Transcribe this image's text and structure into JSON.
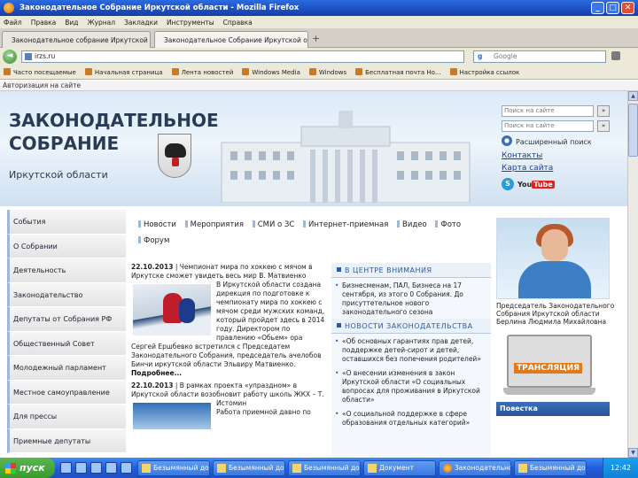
{
  "window": {
    "title": "Законодательное Собрание Иркутской области - Mozilla Firefox",
    "min": "_",
    "max": "□",
    "close": "✕"
  },
  "menu": [
    "Файл",
    "Правка",
    "Вид",
    "Журнал",
    "Закладки",
    "Инструменты",
    "Справка"
  ],
  "tabs": [
    {
      "label": "Законодательное собрание Иркутской"
    },
    {
      "label": "Законодательное Собрание Иркутской обл..."
    }
  ],
  "tab_close": "×",
  "tab_new": "+",
  "nav": {
    "url": "irzs.ru",
    "search_placeholder": "Google",
    "back_glyph": "◄"
  },
  "bookmarks": [
    "Часто посещаемые",
    "Начальная страница",
    "Лента новостей",
    "Windows Media",
    "Windows",
    "Бесплатная почта Ho...",
    "Настройка ссылок"
  ],
  "auth_bar": "Авторизация на сайте",
  "header": {
    "title_line1": "ЗАКОНОДАТЕЛЬНОЕ",
    "title_line2": "СОБРАНИЕ",
    "subtitle": "Иркутской области",
    "search1_placeholder": "Поиск на сайте",
    "search2_placeholder": "Поиск на сайте",
    "search_btn": "»",
    "ext_search": "Расширенный поиск",
    "link_contacts": "Контакты",
    "link_sitemap": "Карта сайта",
    "skype_letter": "S",
    "yt_you": "You",
    "yt_tube": "Tube"
  },
  "leftnav": [
    "События",
    "О Собрании",
    "Деятельность",
    "Законодательство",
    "Депутаты от Собрания РФ",
    "Общественный Совет",
    "Молодежный парламент",
    "Местное самоуправление",
    "Для прессы",
    "Приемные депутаты"
  ],
  "topmenu": [
    "Новости",
    "Мероприятия",
    "СМИ о ЗС",
    "Интернет-приемная",
    "Видео",
    "Фото",
    "Форум"
  ],
  "news": [
    {
      "date": "22.10.2013",
      "headline": "Чемпионат мира по хоккею с мячом в Иркутске сможет увидеть весь мир В. Матвиенко",
      "body": "В Иркутской области создана дирекция по подготовке к чемпионату мира по хоккею с мячом среди мужских команд, который пройдет здесь в 2014 году. Директором по правлению «Обьем» ора Сергей Ершбевко встретился с Председатем Законодательного Собрания, председатель ачелобов Бинчи иркутской области Эльвиру Матвиенко.",
      "more": "Подробнее..."
    },
    {
      "date": "22.10.2013",
      "headline": "В рамках проекта «упраздном» в Иркутской области возобновит работу школь ЖКХ – Т. Истомин",
      "body": "Работа приемной давно по"
    }
  ],
  "center": {
    "head1": "В центре внимания",
    "items1": [
      "Бизнесменам, ПАЛ, Бизнеса на 17 сентября, из этого 0 Собрания. До присуттетельное нового законодательного сезона"
    ],
    "head2": "Новости законодательства",
    "items2": [
      "«Об основных гарантиях прав детей, поддержке детей-сирот и детей, оставшихся без попечения родителей»",
      "«О внесении изменения в закон Иркутской области «О социальных вопросах для проживания в Иркутской области»",
      "«О социальной поддержке в сфере образования отдельных категорий»"
    ]
  },
  "right": {
    "caption": "Председатель Законодательного Собрания Иркутской области Берлина Людмила Михайловна",
    "trans": "ТРАНСЛЯЦИЯ",
    "agenda": "Повестка"
  },
  "taskbar": {
    "start": "пуск",
    "buttons": [
      "Безымянный документ",
      "Безымянный документ",
      "Безымянный документ",
      "Документ",
      "Законодательное...",
      "Безымянный документ"
    ],
    "tray_time": "12:42"
  }
}
